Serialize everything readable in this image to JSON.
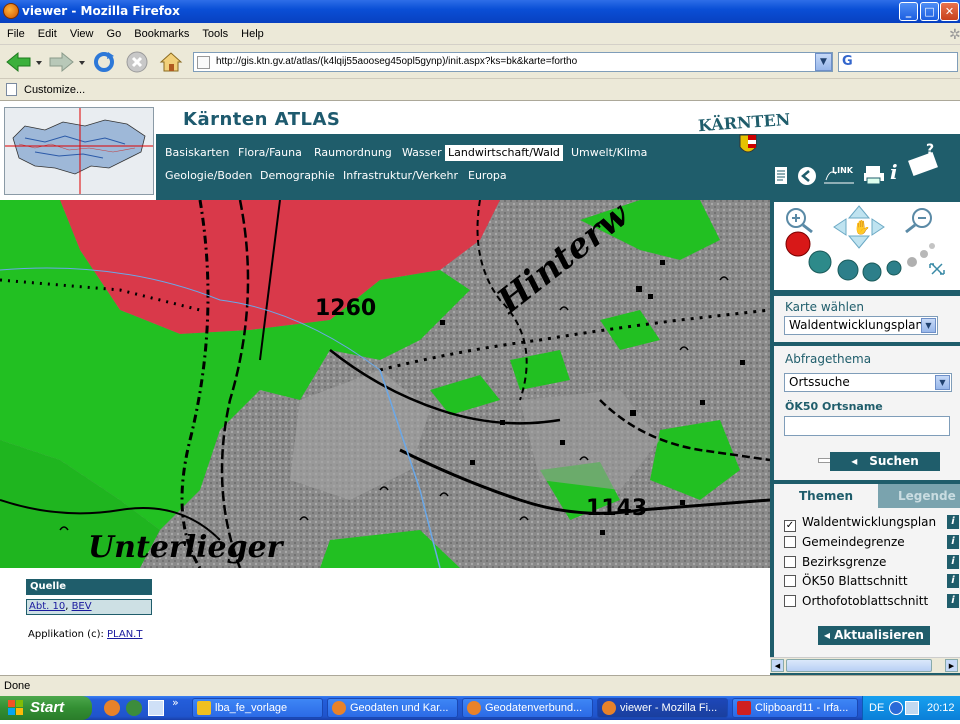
{
  "window": {
    "title": "viewer - Mozilla Firefox"
  },
  "menu": [
    "File",
    "Edit",
    "View",
    "Go",
    "Bookmarks",
    "Tools",
    "Help"
  ],
  "address": {
    "url": "http://gis.ktn.gv.at/atlas/(k4lqij55aooseg45opl5gynp)/init.aspx?ks=bk&karte=fortho"
  },
  "bookmarks": {
    "customize": "Customize..."
  },
  "site": {
    "title": "Kärnten ATLAS",
    "logo_text": "KÄRNTEN",
    "link_label": "LINK",
    "nav_row1": [
      "Basiskarten",
      "Flora/Fauna",
      "Raumordnung",
      "Wasser",
      "Landwirtschaft/Wald",
      "Umwelt/Klima"
    ],
    "nav_row2": [
      "Geologie/Boden",
      "Demographie",
      "Infrastruktur/Verkehr",
      "Europa"
    ],
    "active_nav": "Landwirtschaft/Wald"
  },
  "map_labels": {
    "elev1": "1260",
    "elev2": "1143",
    "name1": "Hinterw",
    "name2": "Unterlieger"
  },
  "panel": {
    "karte_label": "Karte wählen",
    "karte_value": "Waldentwicklungsplan",
    "abfrage_label": "Abfragethema",
    "abfrage_value": "Ortssuche",
    "ortsname_label": "ÖK50 Ortsname",
    "ortsname_value": "",
    "suchen": "Suchen",
    "tab_themen": "Themen",
    "tab_legende": "Legende",
    "layers": [
      {
        "name": "Waldentwicklungsplan",
        "checked": true
      },
      {
        "name": "Gemeindegrenze",
        "checked": false
      },
      {
        "name": "Bezirksgrenze",
        "checked": false
      },
      {
        "name": "ÖK50 Blattschnitt",
        "checked": false
      },
      {
        "name": "Orthofotoblattschnitt",
        "checked": false
      }
    ],
    "aktualisieren": "Aktualisieren"
  },
  "footer": {
    "quelle_label": "Quelle",
    "source1": "Abt. 10",
    "source2": "BEV",
    "app_label": "Applikation (c):",
    "app_link": "PLAN.T"
  },
  "status": "Done",
  "taskbar": {
    "start": "Start",
    "tasks": [
      "lba_fe_vorlage",
      "Geodaten und Kar...",
      "Geodatenverbund...",
      "viewer - Mozilla Fi...",
      "Clipboard11 - Irfa..."
    ],
    "lang": "DE",
    "time": "20:12"
  },
  "colors": {
    "teal": "#1f5d6b",
    "red_zone": "#d9394a",
    "green_zone": "#22c022"
  }
}
